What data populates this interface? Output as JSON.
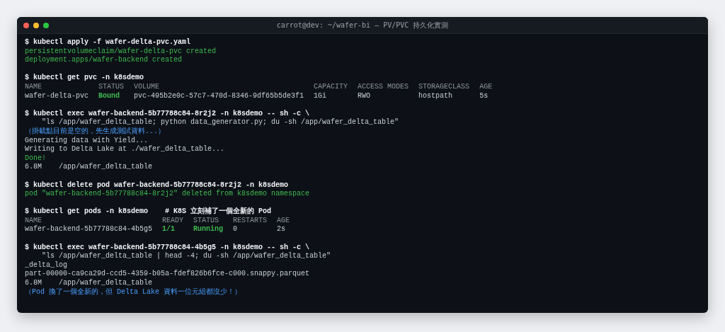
{
  "window": {
    "title": "carrot@dev: ~/wafer-bi — PV/PVC 持久化實測"
  },
  "blocks": [
    {
      "lines": [
        {
          "kind": "command",
          "text": "$ kubectl apply -f wafer-delta-pvc.yaml"
        },
        {
          "kind": "success",
          "text": "persistentvolumeclaim/wafer-delta-pvc created"
        },
        {
          "kind": "success",
          "text": "deployment.apps/wafer-backend created"
        }
      ]
    },
    {
      "lines": [
        {
          "kind": "command",
          "text": "$ kubectl get pvc -n k8sdemo"
        },
        {
          "kind": "table",
          "columns": [
            "NAME",
            "STATUS",
            "VOLUME",
            "CAPACITY",
            "ACCESS MODES",
            "STORAGECLASS",
            "AGE"
          ],
          "rows": [
            [
              {
                "text": "wafer-delta-pvc",
                "highlighted": false
              },
              {
                "text": "Bound",
                "highlighted": true
              },
              {
                "text": "pvc-495b2e0c-57c7-470d-8346-9df65b5de3f1",
                "highlighted": false
              },
              {
                "text": "1Gi",
                "highlighted": false
              },
              {
                "text": "RWO",
                "highlighted": false
              },
              {
                "text": "hostpath",
                "highlighted": false
              },
              {
                "text": "5s",
                "highlighted": false
              }
            ]
          ]
        }
      ]
    },
    {
      "lines": [
        {
          "kind": "command",
          "text": "$ kubectl exec wafer-backend-5b77788c84-8r2j2 -n k8sdemo -- sh -c \\"
        },
        {
          "kind": "continuation",
          "text": "\"ls /app/wafer_delta_table; python data_generator.py; du -sh /app/wafer_delta_table\""
        },
        {
          "kind": "note",
          "text": "（掛載點目前是空的，先生成測試資料...）"
        },
        {
          "kind": "output",
          "text": "Generating data with Yield..."
        },
        {
          "kind": "output",
          "text": "Writing to Delta Lake at ./wafer_delta_table..."
        },
        {
          "kind": "success",
          "text": "Done!"
        },
        {
          "kind": "output",
          "text": "6.8M    /app/wafer_delta_table"
        }
      ]
    },
    {
      "lines": [
        {
          "kind": "command",
          "text": "$ kubectl delete pod wafer-backend-5b77788c84-8r2j2 -n k8sdemo"
        },
        {
          "kind": "success",
          "text": "pod \"wafer-backend-5b77788c84-8r2j2\" deleted from k8sdemo namespace"
        }
      ]
    },
    {
      "lines": [
        {
          "kind": "command",
          "text": "$ kubectl get pods -n k8sdemo    # K8S 立刻補了一個全新的 Pod"
        },
        {
          "kind": "table",
          "columns": [
            "NAME",
            "READY",
            "STATUS",
            "RESTARTS",
            "AGE"
          ],
          "rows": [
            [
              {
                "text": "wafer-backend-5b77788c84-4b5g5",
                "highlighted": false
              },
              {
                "text": "1/1",
                "highlighted": true
              },
              {
                "text": "Running",
                "highlighted": true
              },
              {
                "text": "0",
                "highlighted": false
              },
              {
                "text": "2s",
                "highlighted": false
              }
            ]
          ]
        }
      ]
    },
    {
      "lines": [
        {
          "kind": "command",
          "text": "$ kubectl exec wafer-backend-5b77788c84-4b5g5 -n k8sdemo -- sh -c \\"
        },
        {
          "kind": "continuation",
          "text": "\"ls /app/wafer_delta_table | head -4; du -sh /app/wafer_delta_table\""
        },
        {
          "kind": "output",
          "text": "_delta_log"
        },
        {
          "kind": "output",
          "text": "part-00000-ca9ca29d-ccd5-4359-b05a-fdef826b6fce-c000.snappy.parquet"
        },
        {
          "kind": "output",
          "text": "6.8M    /app/wafer_delta_table"
        },
        {
          "kind": "note",
          "text": "（Pod 換了一個全新的，但 Delta Lake 資料一位元組都沒少！）"
        }
      ]
    }
  ]
}
